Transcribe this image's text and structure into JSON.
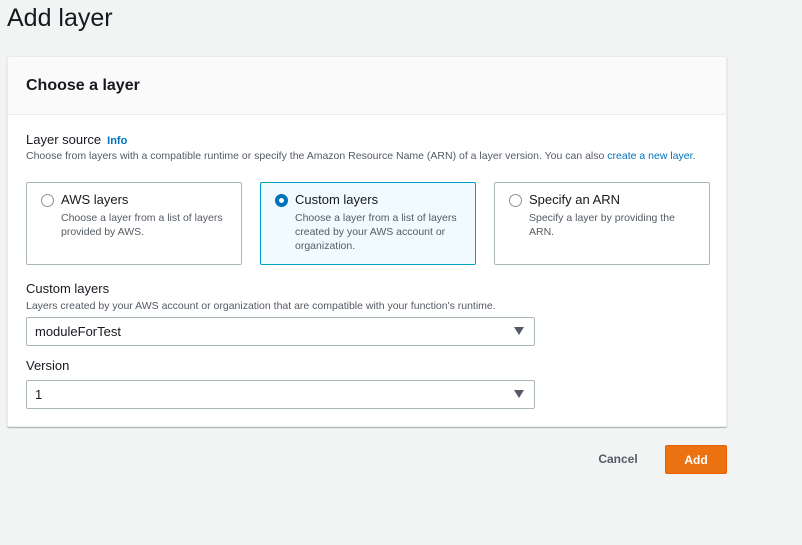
{
  "page": {
    "title": "Add layer"
  },
  "panel": {
    "title": "Choose a layer",
    "layer_source": {
      "label": "Layer source",
      "info": "Info",
      "description": "Choose from layers with a compatible runtime or specify the Amazon Resource Name (ARN) of a layer version. You can also",
      "link": "create a new layer",
      "link_suffix": "."
    },
    "options": [
      {
        "title": "AWS layers",
        "description": "Choose a layer from a list of layers provided by AWS.",
        "selected": false
      },
      {
        "title": "Custom layers",
        "description": "Choose a layer from a list of layers created by your AWS account or organization.",
        "selected": true
      },
      {
        "title": "Specify an ARN",
        "description": "Specify a layer by providing the ARN.",
        "selected": false
      }
    ],
    "custom_layers": {
      "label": "Custom layers",
      "description": "Layers created by your AWS account or organization that are compatible with your function's runtime.",
      "value": "moduleForTest"
    },
    "version": {
      "label": "Version",
      "value": "1"
    }
  },
  "actions": {
    "cancel": "Cancel",
    "add": "Add"
  },
  "colors": {
    "primary": "#ec7211",
    "link": "#0073bb",
    "selected_border": "#00a1c9",
    "selected_bg": "#f1faff"
  }
}
